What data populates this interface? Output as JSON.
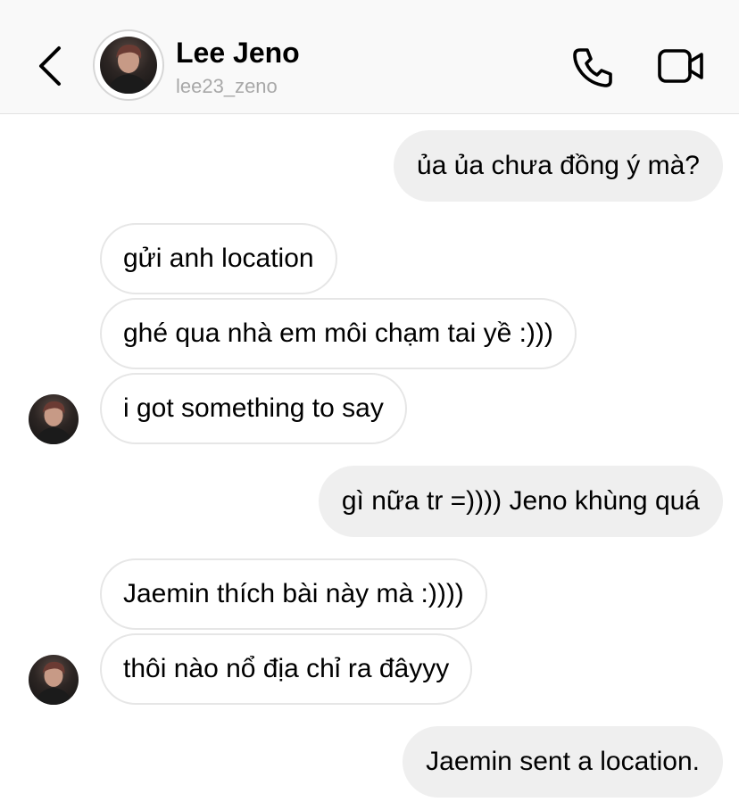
{
  "header": {
    "name": "Lee Jeno",
    "username": "lee23_zeno",
    "back_icon": "chevron-left-icon",
    "call_icon": "phone-icon",
    "video_icon": "video-camera-icon"
  },
  "messages": [
    {
      "from": "me",
      "text": "ủa ủa chưa đồng ý mà?"
    },
    {
      "from": "them",
      "text": "gửi anh location"
    },
    {
      "from": "them",
      "text": "ghé qua nhà em môi chạm tai yề :)))"
    },
    {
      "from": "them",
      "text": "i got something to say"
    },
    {
      "from": "me",
      "text": "gì nữa tr =)))) Jeno khùng quá"
    },
    {
      "from": "them",
      "text": "Jaemin thích bài này mà :))))"
    },
    {
      "from": "them",
      "text": "thôi nào nổ địa chỉ ra đâyyy"
    },
    {
      "from": "me",
      "text": "Jaemin sent a location."
    }
  ],
  "colors": {
    "header_bg": "#f9f9f9",
    "outgoing_bubble": "#efefef",
    "incoming_border": "#e6e6e6",
    "username_text": "#a8a8a8"
  }
}
